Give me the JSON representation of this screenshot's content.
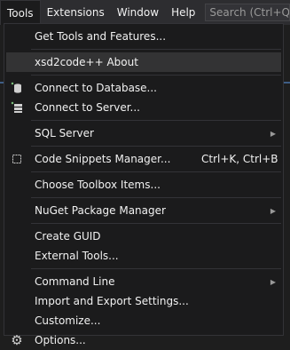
{
  "menubar": {
    "tools": "Tools",
    "extensions": "Extensions",
    "window": "Window",
    "help": "Help",
    "search_placeholder": "Search (Ctrl+Q"
  },
  "menu": {
    "get_tools": "Get Tools and Features...",
    "xsd2code": "xsd2code++ About",
    "connect_db": "Connect to Database...",
    "connect_server": "Connect to Server...",
    "sql_server": "SQL Server",
    "snippets": "Code Snippets Manager...",
    "snippets_shortcut": "Ctrl+K, Ctrl+B",
    "toolbox": "Choose Toolbox Items...",
    "nuget": "NuGet Package Manager",
    "create_guid": "Create GUID",
    "external_tools": "External Tools...",
    "command_line": "Command Line",
    "import_export": "Import and Export Settings...",
    "customize": "Customize...",
    "options": "Options..."
  },
  "colors": {
    "menu_bg": "#1b1b1c",
    "bar_bg": "#2d2d30",
    "highlight": "#333334",
    "text": "#f1f1f1"
  }
}
